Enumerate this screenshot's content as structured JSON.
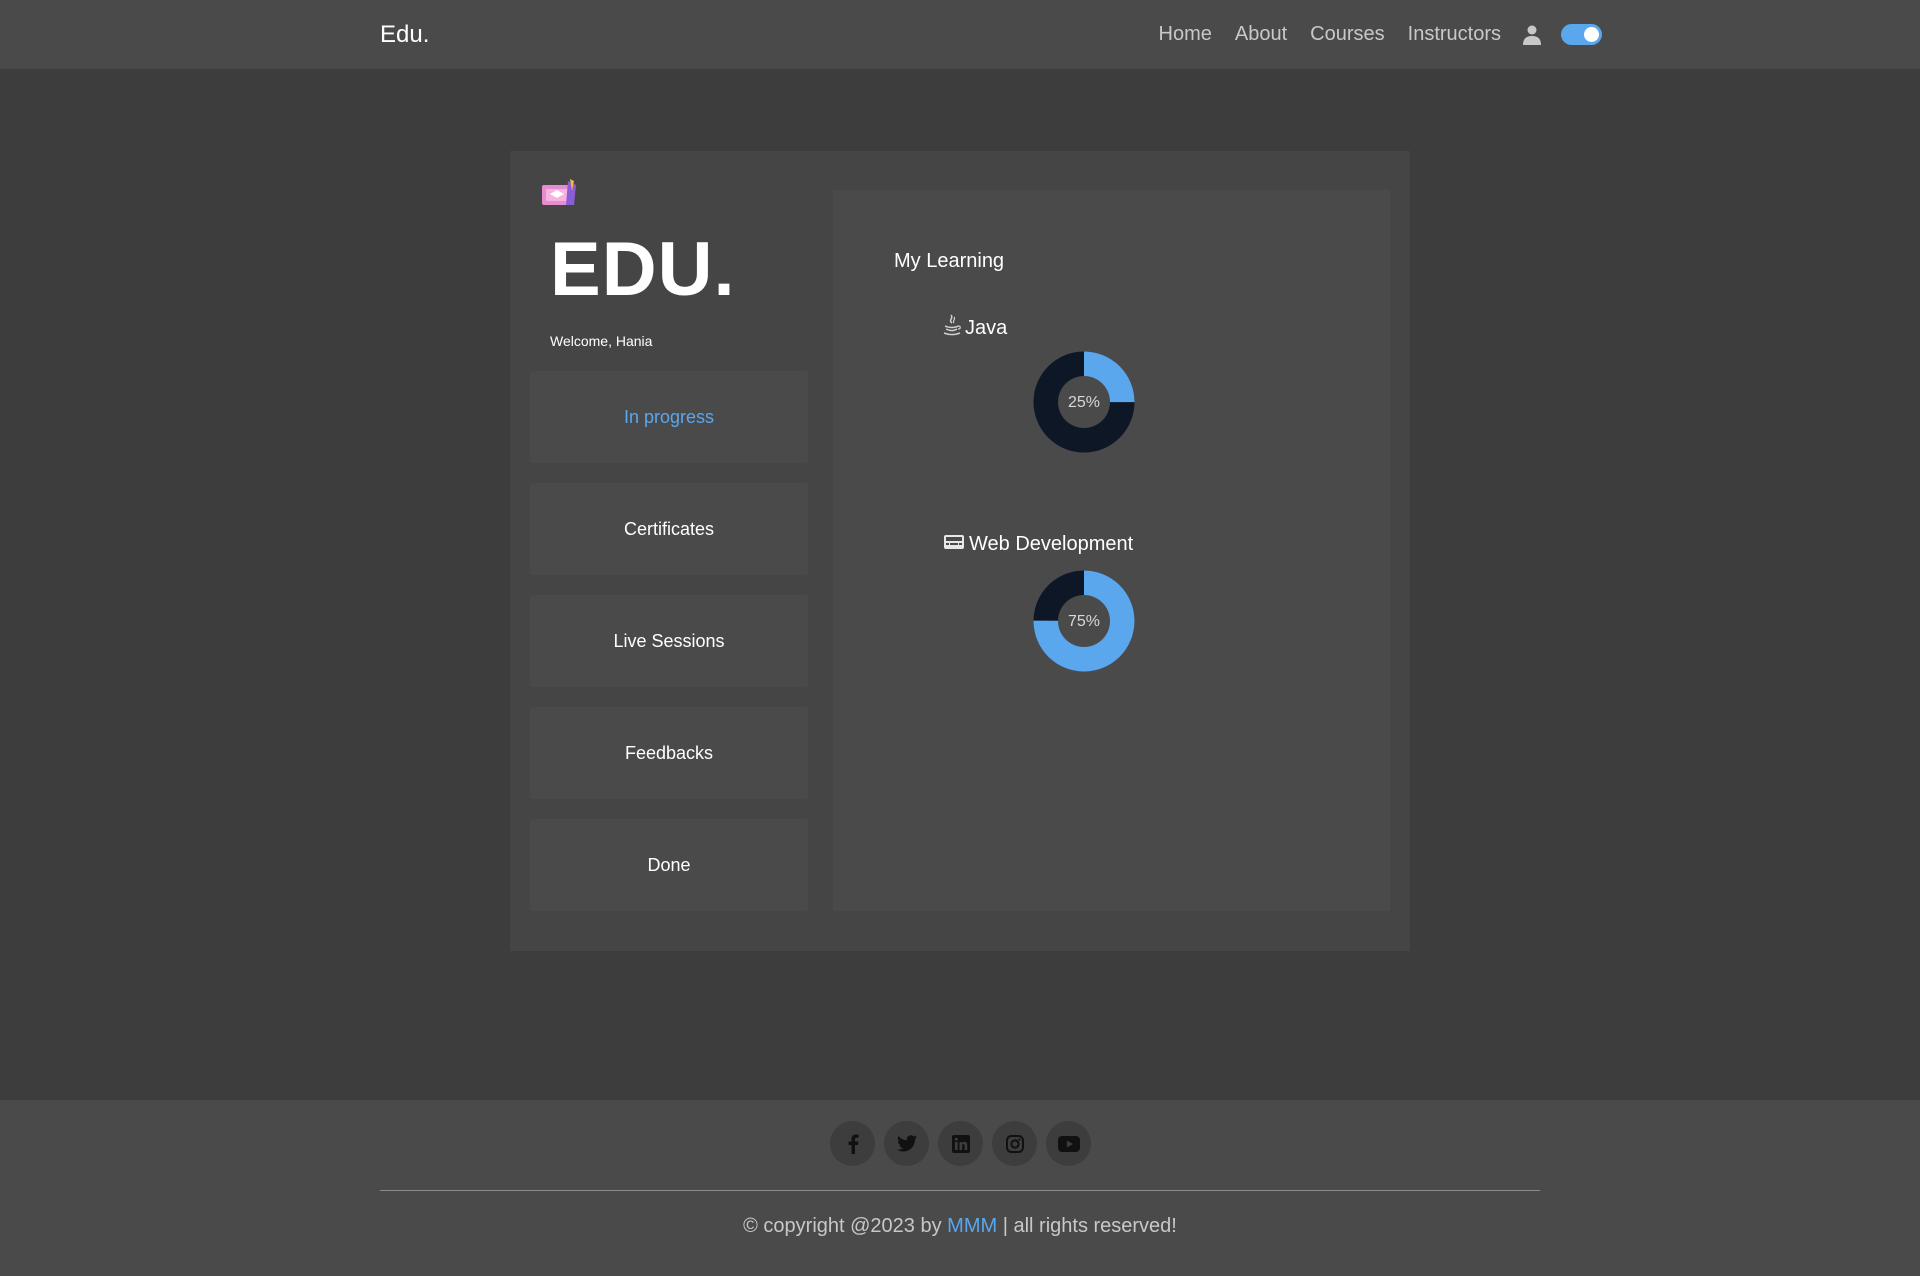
{
  "navbar": {
    "brand": "Edu.",
    "links": [
      "Home",
      "About",
      "Courses",
      "Instructors"
    ],
    "user_icon": "user-icon",
    "theme_toggle_on": true
  },
  "sidebar": {
    "logo_icon": "graduation-ticket-emoji",
    "title": "EDU.",
    "welcome": "Welcome, Hania",
    "items": [
      {
        "label": "In progress",
        "active": true
      },
      {
        "label": "Certificates",
        "active": false
      },
      {
        "label": "Live Sessions",
        "active": false
      },
      {
        "label": "Feedbacks",
        "active": false
      },
      {
        "label": "Done",
        "active": false
      }
    ]
  },
  "learning": {
    "title": "My Learning",
    "courses": [
      {
        "name": "Java",
        "icon": "java-icon",
        "progress": 25,
        "label": "25%"
      },
      {
        "name": "Web Development",
        "icon": "keyboard-icon",
        "progress": 75,
        "label": "75%"
      }
    ]
  },
  "colors": {
    "accent": "#5aa7ee",
    "donut_track": "#0e1726",
    "background": "#3d3d3d",
    "panel": "#4a4a4a"
  },
  "footer": {
    "socials": [
      "facebook-icon",
      "twitter-icon",
      "linkedin-icon",
      "instagram-icon",
      "youtube-icon"
    ],
    "copyright_prefix": "© copyright @2023 by ",
    "copyright_link": "MMM",
    "copyright_suffix": " | all rights reserved!"
  }
}
